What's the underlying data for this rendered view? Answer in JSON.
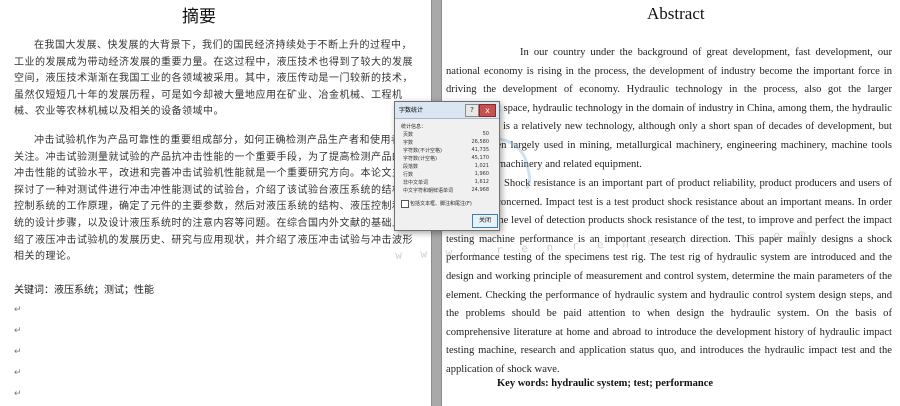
{
  "left_page": {
    "title": "摘要",
    "paragraph_1": "在我国大发展、快发展的大背景下，我们的国民经济持续处于不断上升的过程中，工业的发展成为带动经济发展的重要力量。在这过程中，液压技术也得到了较大的发展空间，液压技术渐渐在我国工业的各领域被采用。其中，液压传动是一门较新的技术，虽然仅短短几十年的发展历程，可是如今却被大量地应用在矿业、冶金机械、工程机械、农业等农林机械以及相关的设备领域中。",
    "paragraph_2": "冲击试验机作为产品可靠性的重要组成部分，如何正确检测产品生产者和使用者的关注。冲击试验测量就试验的产品抗冲击性能的一个重要手段，为了提高检测产品的抗冲击性能的试验水平，改进和完善冲击试验机性能就是一个重要研究方向。本论文主要探讨了一种对测试件进行冲击冲性能测试的试验台，介绍了该试验台液压系统的结构和控制系统的工作原理，确定了元件的主要参数，然后对液压系统的结构、液压控制和系统的设计步骤，以及设计液压系统时的注意内容等问题。在综合国内外文献的基础上介绍了液压冲击试验机的发展历史、研究与应用现状，并介绍了液压冲击试验与冲击波形相关的理论。",
    "keywords": "关键词：液压系统；测试；性能"
  },
  "right_page": {
    "title": "Abstract",
    "paragraph_1": "In our country under the background of great development, fast development, our national economy is rising in the process, the development of industry become the important force in driving the development of economy. Hydraulic technology in the process, also got the larger development space, hydraulic technology in the domain of industry in China, among them, the hydraulic transmission is a relatively new technology, although only a short span of decades of development, but now has been largely used in mining, metallurgical machinery, engineering machinery, machine tools and various machinery and related equipment.",
    "paragraph_2": "Shock resistance is an important part of product reliability, product producers and users of the test are concerned. Impact test is a test product shock resistance about an important means. In order to improve the level of detection products shock resistance of the test, to improve and perfect the impact testing machine performance is an important research direction. This paper mainly designs a shock performance testing of the specimens test rig. The test rig of hydraulic system are introduced and the design and working principle of measurement and control system, determine the main parameters of the element. Checking the performance of hydraulic system and hydraulic control system design steps, and the problems should be paid attention to when design the hydraulic system. On the basis of comprehensive literature at home and abroad to introduce the development history of hydraulic impact testing machine, research and application status quo, and introduces the hydraulic impact test and the application of shock wave.",
    "keywords": "Key words: hydraulic system; test; performance"
  },
  "dialog": {
    "title": "字数统计",
    "help_label": "?",
    "close_x": "x",
    "section_label": "统计信息：",
    "stats": [
      {
        "label": "页数",
        "value": "50"
      },
      {
        "label": "字数",
        "value": "26,580"
      },
      {
        "label": "字符数(不计空格)",
        "value": "41,735"
      },
      {
        "label": "字符数(计空格)",
        "value": "45,170"
      },
      {
        "label": "段落数",
        "value": "1,021"
      },
      {
        "label": "行数",
        "value": "1,960"
      },
      {
        "label": "非中文单词",
        "value": "1,612"
      },
      {
        "label": "中文字符和朝鲜语单词",
        "value": "24,968"
      }
    ],
    "checkbox_label": "包括文本框、脚注和尾注(F)",
    "close_button": "关闭"
  },
  "watermark_text": "w w w . r e n r e n d o c . c o m"
}
